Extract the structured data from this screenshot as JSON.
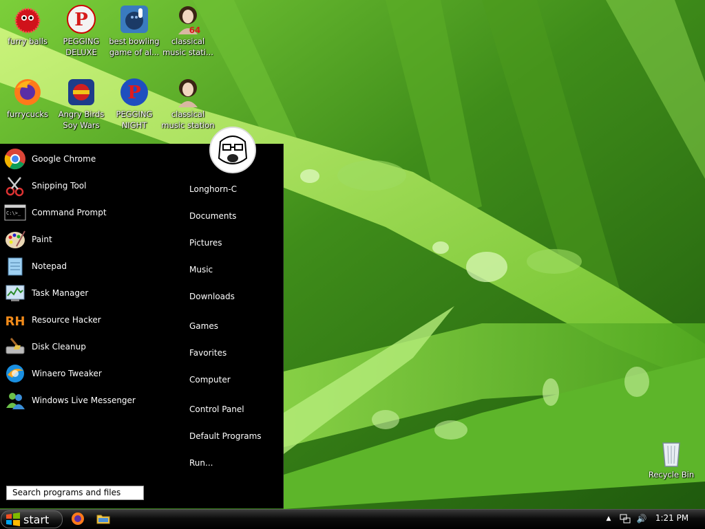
{
  "desktop": {
    "icons": [
      {
        "label": "furry balls"
      },
      {
        "label": "PEGGING\nDELUXE"
      },
      {
        "label": "best bowling\ngame of al..."
      },
      {
        "label": "classical\nmusic stati..."
      },
      {
        "label": "furrycucks"
      },
      {
        "label": "Angry Birds\nSoy Wars"
      },
      {
        "label": "PEGGING\nNIGHT"
      },
      {
        "label": "classical\nmusic station"
      },
      {
        "label": "Recycle Bin"
      }
    ],
    "icon_badge": "64"
  },
  "start_menu": {
    "programs": [
      {
        "label": "Google Chrome",
        "icon": "chrome-icon"
      },
      {
        "label": "Snipping Tool",
        "icon": "scissors-icon"
      },
      {
        "label": "Command Prompt",
        "icon": "terminal-icon"
      },
      {
        "label": "Paint",
        "icon": "palette-icon"
      },
      {
        "label": "Notepad",
        "icon": "notepad-icon"
      },
      {
        "label": "Task Manager",
        "icon": "task-manager-icon"
      },
      {
        "label": "Resource Hacker",
        "icon": "resource-hacker-icon"
      },
      {
        "label": "Disk Cleanup",
        "icon": "disk-cleanup-icon"
      },
      {
        "label": "Winaero Tweaker",
        "icon": "winaero-icon"
      },
      {
        "label": "Windows Live Messenger",
        "icon": "messenger-icon"
      }
    ],
    "places": [
      "Longhorn-C",
      "Documents",
      "Pictures",
      "Music",
      "Downloads",
      "Games",
      "Favorites",
      "Computer",
      "Control Panel",
      "Default Programs",
      "Run..."
    ],
    "search_placeholder": "Search programs and files",
    "rh_glyph": "RH",
    "cmd_glyph": "C:\\>_"
  },
  "taskbar": {
    "start_label": "start",
    "clock": "1:21 PM",
    "tray_arrow": "▲",
    "speaker_glyph": "🔊"
  },
  "colors": {
    "start_menu_bg": "#000000",
    "taskbar_bg": "#0c0c0c",
    "desktop_label": "#ffffff"
  }
}
